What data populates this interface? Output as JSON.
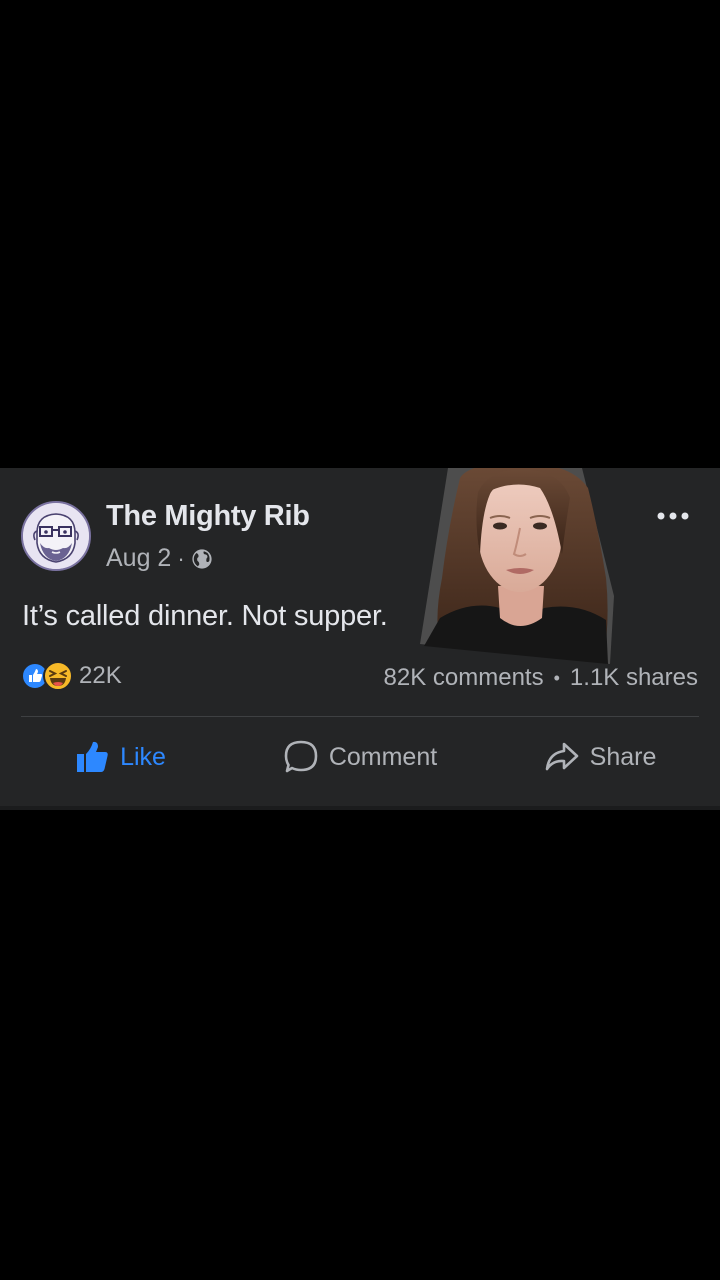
{
  "post": {
    "author": "The Mighty Rib",
    "date": "Aug 2",
    "meta_separator": "·",
    "text": "It’s called dinner. Not supper.",
    "reaction_count": "22K",
    "comments": "82K comments",
    "engagement_separator": "•",
    "shares": "1.1K shares",
    "audience_icon": "globe-icon",
    "reaction_icons": [
      "like-reaction-icon",
      "haha-reaction-icon"
    ]
  },
  "actions": {
    "like_label": "Like",
    "comment_label": "Comment",
    "share_label": "Share"
  },
  "colors": {
    "background": "#000000",
    "card": "#242526",
    "primary_text": "#e4e6eb",
    "secondary_text": "#b0b3b8",
    "accent_blue": "#2d88ff",
    "haha_yellow": "#f7b928"
  }
}
